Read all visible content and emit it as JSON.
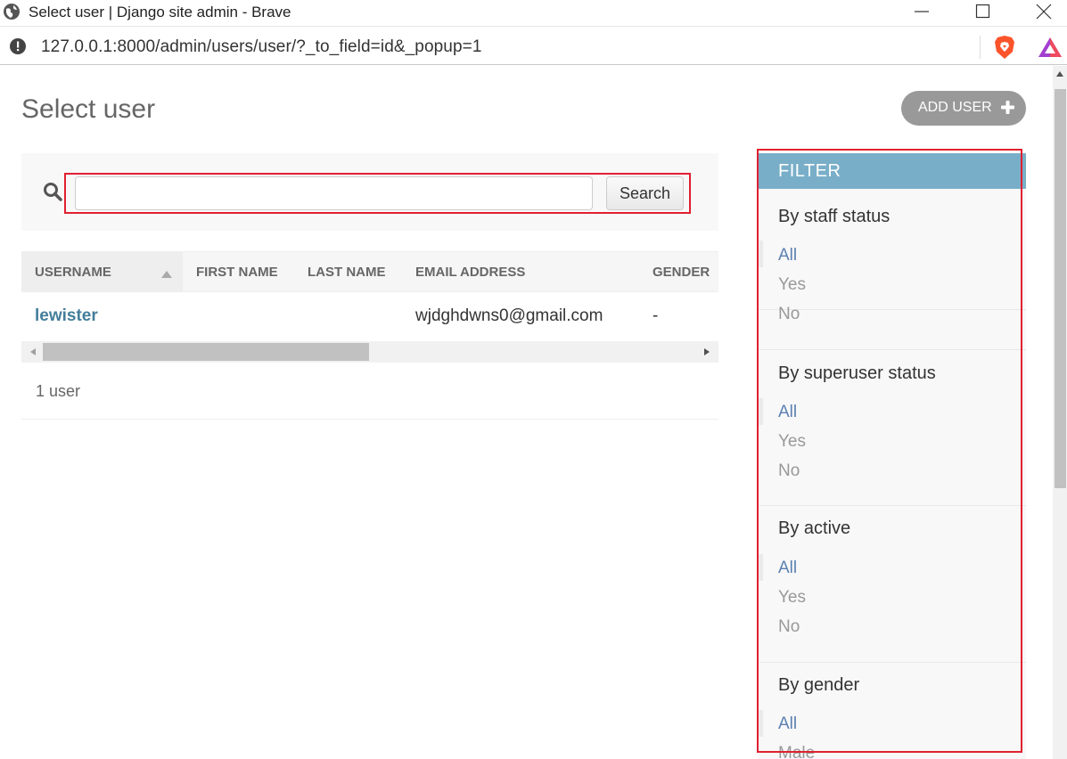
{
  "window": {
    "title": "Select user | Django site admin - Brave"
  },
  "address_bar": {
    "url": "127.0.0.1:8000/admin/users/user/?_to_field=id&_popup=1"
  },
  "page": {
    "title": "Select user",
    "add_button": "ADD USER"
  },
  "search": {
    "value": "",
    "button_label": "Search"
  },
  "table": {
    "columns": [
      "USERNAME",
      "FIRST NAME",
      "LAST NAME",
      "EMAIL ADDRESS",
      "GENDER"
    ],
    "rows": [
      {
        "username": "lewister",
        "first_name": "",
        "last_name": "",
        "email": "wjdghdwns0@gmail.com",
        "gender": "-"
      }
    ],
    "sorted_column": "USERNAME",
    "sort_direction": "ascending"
  },
  "paginator": {
    "count_text": "1 user"
  },
  "filter": {
    "header": "FILTER",
    "groups": [
      {
        "title": "By staff status",
        "options": [
          "All",
          "Yes",
          "No"
        ],
        "selected": "All"
      },
      {
        "title": "By superuser status",
        "options": [
          "All",
          "Yes",
          "No"
        ],
        "selected": "All"
      },
      {
        "title": "By active",
        "options": [
          "All",
          "Yes",
          "No"
        ],
        "selected": "All"
      },
      {
        "title": "By gender",
        "options": [
          "All",
          "Male"
        ],
        "selected": "All"
      }
    ]
  },
  "colors": {
    "filter_header": "#79aec8",
    "link": "#447e9b",
    "selected_filter": "#5b80b2",
    "highlight_box": "#e02030",
    "add_button": "#999999"
  }
}
